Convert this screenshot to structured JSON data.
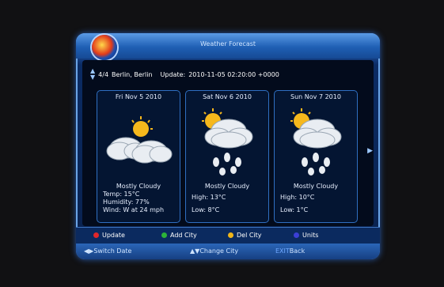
{
  "header": {
    "title": "Weather Forecast"
  },
  "location": {
    "index": "4/4",
    "city": "Berlin, Berlin",
    "update_label": "Update:",
    "update_time": "2010-11-05 02:20:00 +0000"
  },
  "days": [
    {
      "date": "Fri Nov  5 2010",
      "icon": "mostly-cloudy-icon",
      "condition": "Mostly Cloudy",
      "lines": [
        "Temp:   15°C",
        "Humidity: 77%",
        "Wind: W at 24 mph"
      ]
    },
    {
      "date": "Sat Nov  6 2010",
      "icon": "rain-cloud-icon",
      "condition": "Mostly Cloudy",
      "lines": [
        "High:   13°C",
        "Low:    8°C"
      ]
    },
    {
      "date": "Sun Nov  7 2010",
      "icon": "rain-cloud-icon",
      "condition": "Mostly Cloudy",
      "lines": [
        "High:   10°C",
        "Low:    1°C"
      ]
    }
  ],
  "legend": [
    {
      "label": "Update",
      "color": "#e0262a"
    },
    {
      "label": "Add City",
      "color": "#2cb339"
    },
    {
      "label": "Del City",
      "color": "#f0b51a"
    },
    {
      "label": "Units",
      "color": "#3b3fd6"
    }
  ],
  "hints": {
    "switch_date": "Switch Date",
    "change_city": "Change City",
    "exit_key": "EXIT",
    "exit_label": "Back"
  }
}
